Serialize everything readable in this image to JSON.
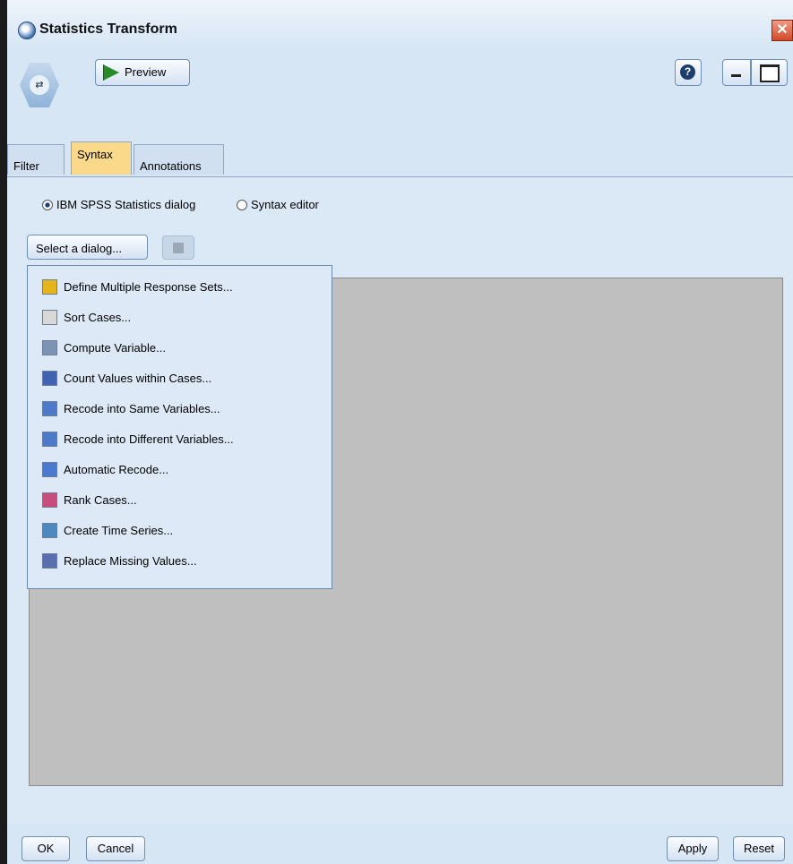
{
  "window": {
    "title": "Statistics Transform",
    "close_glyph": "✕"
  },
  "toolbar": {
    "preview_label": "Preview",
    "help_glyph": "?"
  },
  "tabs": [
    {
      "label": "Filter",
      "active": false
    },
    {
      "label": "Syntax",
      "active": true
    },
    {
      "label": "Annotations",
      "active": false
    }
  ],
  "syntax": {
    "radio_dialog_label": "IBM SPSS Statistics dialog",
    "radio_dialog_selected": true,
    "radio_editor_label": "Syntax editor",
    "radio_editor_selected": false,
    "select_dialog_label": "Select a dialog..."
  },
  "menu": {
    "items": [
      {
        "label": "Define Multiple Response Sets...",
        "icon": "grid-icon",
        "color": "#e5b51e"
      },
      {
        "label": "Sort Cases...",
        "icon": "sort-icon",
        "color": "#d8d8d8"
      },
      {
        "label": "Compute Variable...",
        "icon": "calculator-icon",
        "color": "#7d93b4"
      },
      {
        "label": "Count Values within Cases...",
        "icon": "count-icon",
        "color": "#3f62b2"
      },
      {
        "label": "Recode into Same Variables...",
        "icon": "recode-same-icon",
        "color": "#4e78c8"
      },
      {
        "label": "Recode into Different Variables...",
        "icon": "recode-different-icon",
        "color": "#4e78c8"
      },
      {
        "label": "Automatic Recode...",
        "icon": "auto-recode-icon",
        "color": "#4a7ad0"
      },
      {
        "label": "Rank Cases...",
        "icon": "rank-icon",
        "color": "#c94d7c"
      },
      {
        "label": "Create Time Series...",
        "icon": "time-series-icon",
        "color": "#4e88c0"
      },
      {
        "label": "Replace Missing Values...",
        "icon": "replace-missing-icon",
        "color": "#5b6fb0"
      }
    ]
  },
  "footer": {
    "ok_label": "OK",
    "cancel_label": "Cancel",
    "apply_label": "Apply",
    "reset_label": "Reset"
  }
}
